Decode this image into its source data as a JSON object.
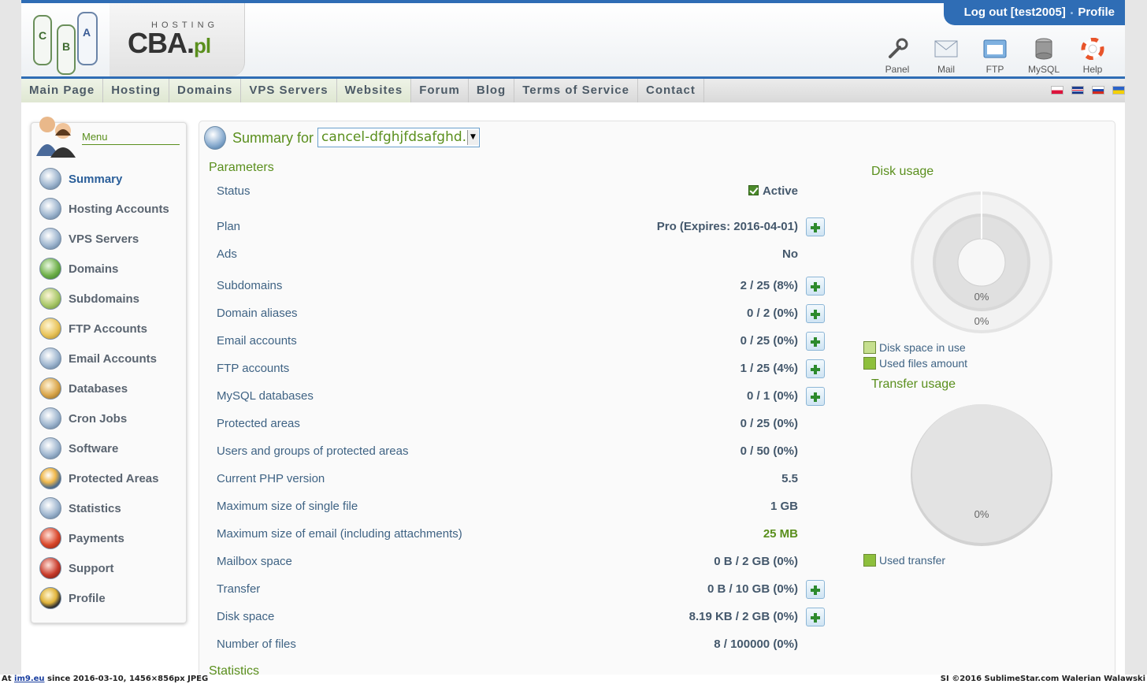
{
  "header": {
    "brand_small": "HOSTING",
    "brand_main": "CBA.",
    "brand_suffix": "pl",
    "logout_label": "Log out [test2005]",
    "separator": "•",
    "profile_label": "Profile",
    "tools": [
      {
        "label": "Panel",
        "icon": "wrench-icon"
      },
      {
        "label": "Mail",
        "icon": "mail-icon"
      },
      {
        "label": "FTP",
        "icon": "ftp-icon"
      },
      {
        "label": "MySQL",
        "icon": "database-icon"
      },
      {
        "label": "Help",
        "icon": "lifebuoy-icon"
      }
    ]
  },
  "nav": {
    "items": [
      "Main Page",
      "Hosting",
      "Domains",
      "VPS Servers",
      "Websites",
      "Forum",
      "Blog",
      "Terms of Service",
      "Contact"
    ],
    "flags": [
      "flag-pl-icon",
      "flag-uk-icon",
      "flag-ru-icon",
      "flag-ua-icon"
    ]
  },
  "sidebar": {
    "title": "Menu",
    "items": [
      {
        "label": "Summary",
        "icon": "summary-icon",
        "active": true
      },
      {
        "label": "Hosting Accounts",
        "icon": "hosting-accounts-icon"
      },
      {
        "label": "VPS Servers",
        "icon": "vps-server-icon"
      },
      {
        "label": "Domains",
        "icon": "globe-icon"
      },
      {
        "label": "Subdomains",
        "icon": "subdomain-globe-icon"
      },
      {
        "label": "FTP Accounts",
        "icon": "folder-icon"
      },
      {
        "label": "Email Accounts",
        "icon": "envelope-icon"
      },
      {
        "label": "Databases",
        "icon": "database-icon"
      },
      {
        "label": "Cron Jobs",
        "icon": "clock-icon"
      },
      {
        "label": "Software",
        "icon": "gear-icon"
      },
      {
        "label": "Protected Areas",
        "icon": "lightning-icon"
      },
      {
        "label": "Statistics",
        "icon": "chart-icon"
      },
      {
        "label": "Payments",
        "icon": "dollar-icon"
      },
      {
        "label": "Support",
        "icon": "support-person-icon"
      },
      {
        "label": "Profile",
        "icon": "profile-person-icon"
      }
    ]
  },
  "main": {
    "title": "Summary for",
    "selected_account": "cancel-dfghjfdsafghd.",
    "parameters_heading": "Parameters",
    "statistics_heading": "Statistics",
    "params": [
      {
        "label": "Status",
        "value": "Active",
        "check": true,
        "plus": false
      },
      {
        "label": "Plan",
        "value": "Pro (Expires: 2016-04-01)",
        "plus": true
      },
      {
        "label": "Ads",
        "value": "No",
        "plus": false
      },
      {
        "label": "Subdomains",
        "value": "2 / 25 (8%)",
        "plus": true
      },
      {
        "label": "Domain aliases",
        "value": "0 / 2 (0%)",
        "plus": true
      },
      {
        "label": "Email accounts",
        "value": "0 / 25 (0%)",
        "plus": true
      },
      {
        "label": "FTP accounts",
        "value": "1 / 25 (4%)",
        "plus": true
      },
      {
        "label": "MySQL databases",
        "value": "0 / 1 (0%)",
        "plus": true
      },
      {
        "label": "Protected areas",
        "value": "0 / 25 (0%)",
        "plus": false
      },
      {
        "label": "Users and groups of protected areas",
        "value": "0 / 50 (0%)",
        "plus": false
      },
      {
        "label": "Current PHP version",
        "value": "5.5",
        "plus": false
      },
      {
        "label": "Maximum size of single file",
        "value": "1 GB",
        "plus": false
      },
      {
        "label": "Maximum size of email (including attachments)",
        "value": "25 MB",
        "green": true,
        "plus": false
      },
      {
        "label": "Mailbox space",
        "value": "0 B / 2 GB (0%)",
        "plus": false
      },
      {
        "label": "Transfer",
        "value": "0 B / 10 GB (0%)",
        "plus": true
      },
      {
        "label": "Disk space",
        "value": "8.19 KB / 2 GB (0%)",
        "plus": true
      },
      {
        "label": "Number of files",
        "value": "8 / 100000 (0%)",
        "plus": false
      }
    ]
  },
  "charts": {
    "disk": {
      "heading": "Disk usage",
      "inner_label": "0%",
      "outer_label": "0%",
      "legend": [
        {
          "label": "Disk space in use",
          "color": "#c6df8f"
        },
        {
          "label": "Used files amount",
          "color": "#8dbf3c"
        }
      ]
    },
    "transfer": {
      "heading": "Transfer usage",
      "label": "0%",
      "legend": [
        {
          "label": "Used transfer",
          "color": "#8dbf3c"
        }
      ]
    }
  },
  "chart_data": [
    {
      "type": "pie",
      "title": "Disk usage",
      "series": [
        {
          "name": "Disk space in use",
          "values": [
            0
          ]
        },
        {
          "name": "Used files amount",
          "values": [
            0
          ]
        }
      ]
    },
    {
      "type": "pie",
      "title": "Transfer usage",
      "series": [
        {
          "name": "Used transfer",
          "values": [
            0
          ]
        }
      ]
    }
  ],
  "footer": {
    "left_prefix": "At ",
    "left_link": "im9.eu",
    "left_suffix": " since 2016-03-10, 1456×856px JPEG",
    "right": "SI ©2016 SublimeStar.com Walerian Walawski"
  }
}
